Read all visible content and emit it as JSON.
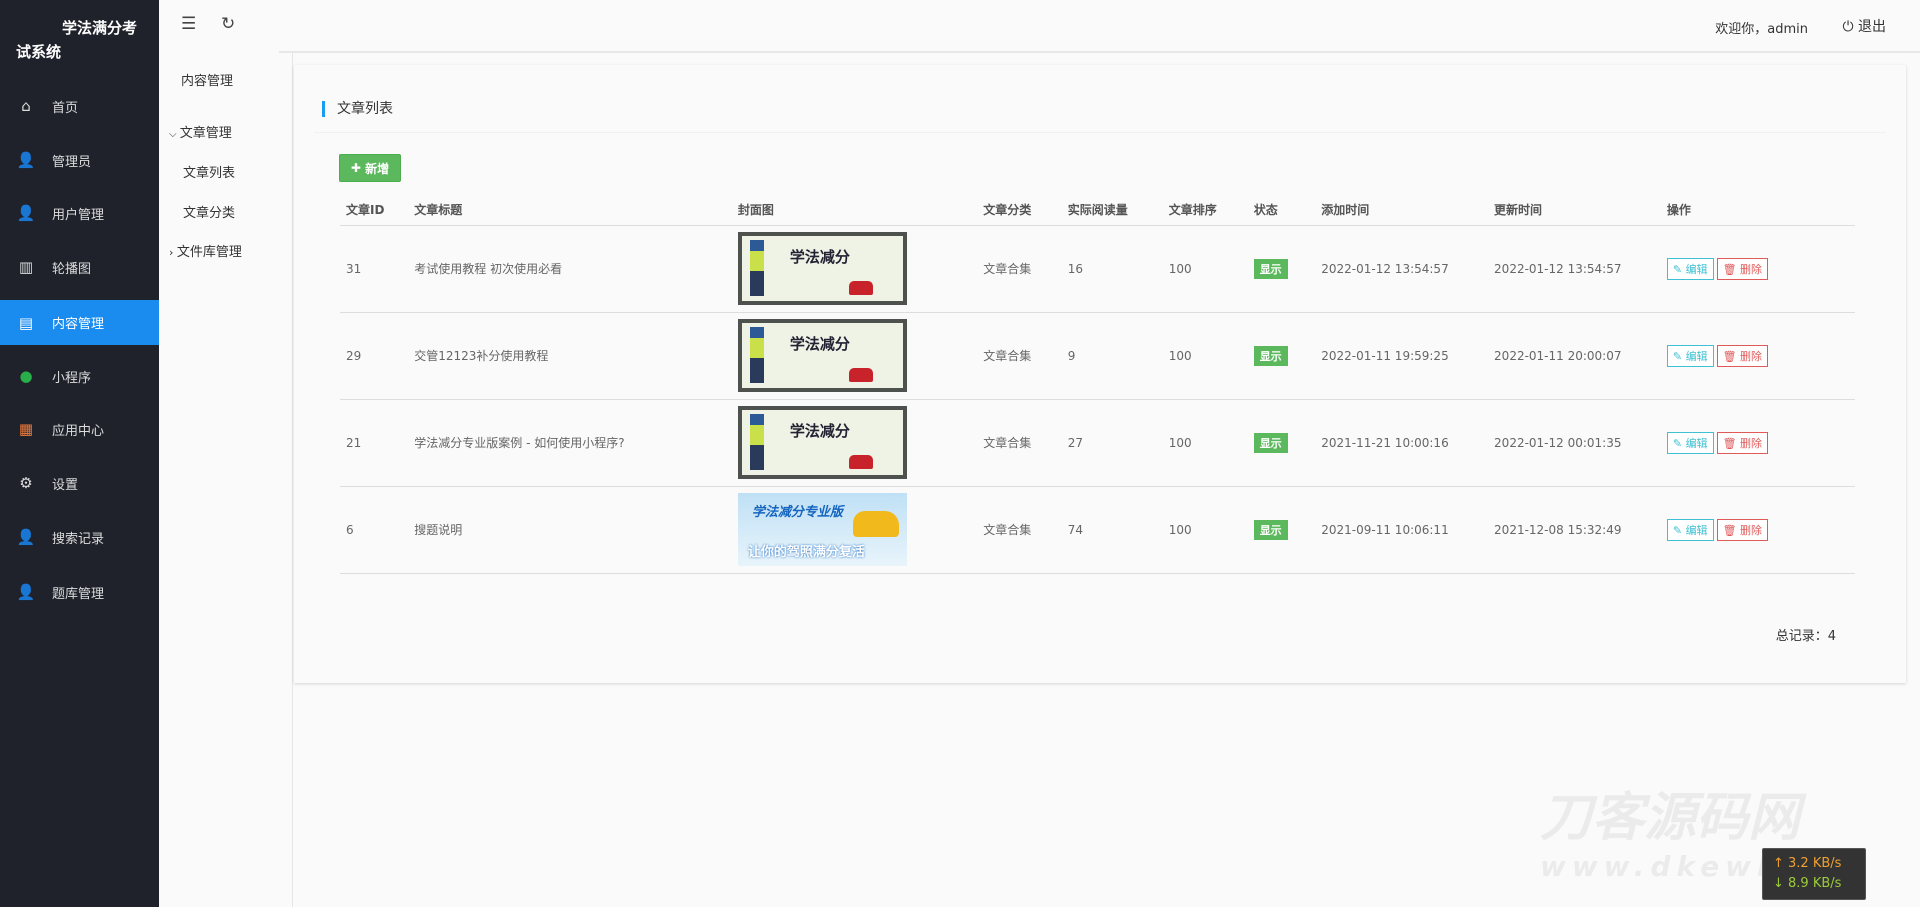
{
  "app": {
    "title_line1": "学法满分考",
    "title_line2": "试系统"
  },
  "sidebar": {
    "items": [
      {
        "label": "首页",
        "icon": "home-icon",
        "glyph": "⌂"
      },
      {
        "label": "管理员",
        "icon": "user-gear-icon",
        "glyph": "👤"
      },
      {
        "label": "用户管理",
        "icon": "user-icon",
        "glyph": "👤"
      },
      {
        "label": "轮播图",
        "icon": "books-icon",
        "glyph": "▥"
      },
      {
        "label": "内容管理",
        "icon": "document-icon",
        "glyph": "▤",
        "active": true
      },
      {
        "label": "小程序",
        "icon": "mini-program-icon",
        "glyph": "●"
      },
      {
        "label": "应用中心",
        "icon": "apps-icon",
        "glyph": "▦"
      },
      {
        "label": "设置",
        "icon": "gear-icon",
        "glyph": "⚙"
      },
      {
        "label": "搜索记录",
        "icon": "user-gear-icon",
        "glyph": "👤"
      },
      {
        "label": "题库管理",
        "icon": "user-gear-icon",
        "glyph": "👤"
      }
    ]
  },
  "subnav": {
    "title": "内容管理",
    "groups": [
      {
        "label": "文章管理",
        "expanded": true,
        "items": [
          "文章列表",
          "文章分类"
        ]
      },
      {
        "label": "文件库管理",
        "expanded": false
      }
    ]
  },
  "header": {
    "welcome": "欢迎你，admin",
    "logout": "退出"
  },
  "card": {
    "title": "文章列表",
    "add_label": "新增"
  },
  "table": {
    "columns": [
      "文章ID",
      "文章标题",
      "封面图",
      "文章分类",
      "实际阅读量",
      "文章排序",
      "状态",
      "添加时间",
      "更新时间",
      "操作"
    ],
    "rows": [
      {
        "id": "31",
        "title": "考试使用教程 初次使用必看",
        "cover": "traffic-police",
        "cover_text": "学法减分",
        "category": "文章合集",
        "reads": "16",
        "sort": "100",
        "status": "显示",
        "added": "2022-01-12 13:54:57",
        "updated": "2022-01-12 13:54:57"
      },
      {
        "id": "29",
        "title": "交管12123补分使用教程",
        "cover": "traffic-police",
        "cover_text": "学法减分",
        "category": "文章合集",
        "reads": "9",
        "sort": "100",
        "status": "显示",
        "added": "2022-01-11 19:59:25",
        "updated": "2022-01-11 20:00:07"
      },
      {
        "id": "21",
        "title": "学法减分专业版案例 - 如何使用小程序?",
        "cover": "traffic-police",
        "cover_text": "学法减分",
        "category": "文章合集",
        "reads": "27",
        "sort": "100",
        "status": "显示",
        "added": "2021-11-21 10:00:16",
        "updated": "2022-01-12 00:01:35"
      },
      {
        "id": "6",
        "title": "搜题说明",
        "cover": "yellow-car",
        "cover_text": "学法减分专业版",
        "cover_text2": "让你的驾照满分复活",
        "category": "文章合集",
        "reads": "74",
        "sort": "100",
        "status": "显示",
        "added": "2021-09-11 10:06:11",
        "updated": "2021-12-08 15:32:49"
      }
    ],
    "edit_label": "编辑",
    "delete_label": "删除"
  },
  "footer": {
    "total": "总记录：4"
  },
  "watermark": {
    "text": "刀客源码网",
    "url": "www.dkewl.com"
  },
  "network": {
    "up": "↑ 3.2 KB/s",
    "down": "↓ 8.9 KB/s"
  },
  "colors": {
    "sidebar_bg": "#1f222b",
    "active": "#1a8bef",
    "success": "#5cb85c",
    "edit": "#3fc0d3",
    "delete": "#e05a5a"
  }
}
